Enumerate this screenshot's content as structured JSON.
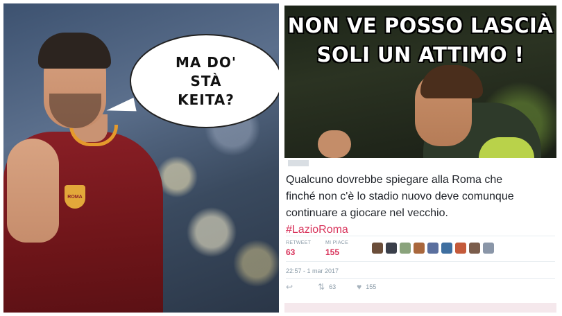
{
  "left": {
    "bubble_lines": [
      "MA DO'",
      "STÀ",
      "KEITA?"
    ],
    "crest_text": "ROMA"
  },
  "right": {
    "meme_lines": [
      "NON VE POSSO LASCIÀ",
      "SOLI UN ATTIMO !"
    ],
    "tweet_lines": [
      "Qualcuno dovrebbe spiegare alla Roma che",
      "finché non c'è lo stadio nuovo deve comunque",
      "continuare a giocare nel vecchio."
    ],
    "hashtag": "#LazioRoma",
    "stats": {
      "retweet_label": "RETWEET",
      "retweet_value": "63",
      "likes_label": "MI PIACE",
      "likes_value": "155"
    },
    "timestamp": "22:57 - 1 mar 2017",
    "actions": {
      "reply_icon": "reply-icon",
      "retweet_icon": "retweet-icon",
      "retweet_count": "63",
      "like_icon": "heart-icon",
      "like_count": "155"
    },
    "colors": {
      "hashtag": "#d8325a",
      "stat_value": "#d8325a",
      "meta_gray": "#8899a6"
    }
  }
}
